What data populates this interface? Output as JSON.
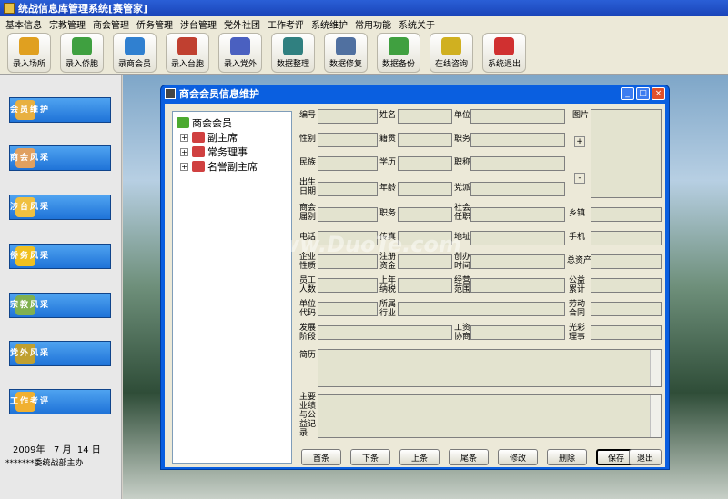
{
  "app": {
    "title": "统战信息库管理系统[赛管家]"
  },
  "menu": [
    "基本信息",
    "宗教管理",
    "商会管理",
    "侨务管理",
    "涉台管理",
    "党外社团",
    "工作考评",
    "系统维护",
    "常用功能",
    "系统关于"
  ],
  "toolbar": [
    {
      "label": "录入场所",
      "icon": "building-icon",
      "color": "#e0a020"
    },
    {
      "label": "录入侨胞",
      "icon": "download-icon",
      "color": "#3fa040"
    },
    {
      "label": "录商会员",
      "icon": "pencil-icon",
      "color": "#3080d0"
    },
    {
      "label": "录入台胞",
      "icon": "book-icon",
      "color": "#c04030"
    },
    {
      "label": "录入党外",
      "icon": "people-icon",
      "color": "#4a60c0"
    },
    {
      "label": "数据整理",
      "icon": "data-icon",
      "color": "#308080"
    },
    {
      "label": "数据修复",
      "icon": "disk-repair-icon",
      "color": "#5070a0"
    },
    {
      "label": "数据备份",
      "icon": "backup-icon",
      "color": "#40a040"
    },
    {
      "label": "在线咨询",
      "icon": "chat-icon",
      "color": "#d0b020"
    },
    {
      "label": "系统退出",
      "icon": "power-icon",
      "color": "#d03030"
    }
  ],
  "sidebar": [
    {
      "label": "会员维护",
      "icon": "members-icon",
      "color": "#e8b040"
    },
    {
      "label": "商会风采",
      "icon": "chamber-icon",
      "color": "#e0a060"
    },
    {
      "label": "涉台风采",
      "icon": "taiwan-icon",
      "color": "#f0c040"
    },
    {
      "label": "侨务风采",
      "icon": "overseas-icon",
      "color": "#f0c020"
    },
    {
      "label": "宗教风采",
      "icon": "religion-icon",
      "color": "#80b050"
    },
    {
      "label": "党外风采",
      "icon": "party-icon",
      "color": "#c0a030"
    },
    {
      "label": "工作考评",
      "icon": "evaluation-icon",
      "color": "#f0b030"
    }
  ],
  "date": {
    "year": "2009年",
    "month": "7 月",
    "day": "14 日"
  },
  "footer": "*******委统战部主办",
  "dialog": {
    "title": "商会会员信息维护",
    "tree": {
      "root": "商会会员",
      "children": [
        "副主席",
        "常务理事",
        "名誉副主席"
      ]
    },
    "labels": {
      "code": "编号",
      "name": "姓名",
      "unit": "单位",
      "photo": "图片",
      "gender": "性别",
      "origin": "籍贯",
      "duty": "职务",
      "ethnicity": "民族",
      "education": "学历",
      "title": "职称",
      "birth": "出生日期",
      "age": "年龄",
      "party": "党派",
      "term": "商会届别",
      "duty2": "职务",
      "social": "社会任职",
      "township": "乡镇",
      "phone": "电话",
      "fax": "传真",
      "address": "地址",
      "mobile": "手机",
      "enterprise": "企业性质",
      "capital": "注册资金",
      "founded": "创办时间",
      "assets": "总资产",
      "staff": "员工人数",
      "tax": "上年纳税",
      "scope": "经营范围",
      "charity": "公益累计",
      "unitcode": "单位代码",
      "industry": "所属行业",
      "labor": "劳动合同",
      "stage": "发展阶段",
      "wage": "工资协商",
      "guangcai": "光彩理事",
      "resume": "简历",
      "achievements": "主要业绩与公益记录"
    },
    "buttons": [
      "首条",
      "下条",
      "上条",
      "尾条",
      "修改",
      "删除",
      "保存",
      "退出"
    ]
  },
  "watermark": "www.DuoTe.com"
}
